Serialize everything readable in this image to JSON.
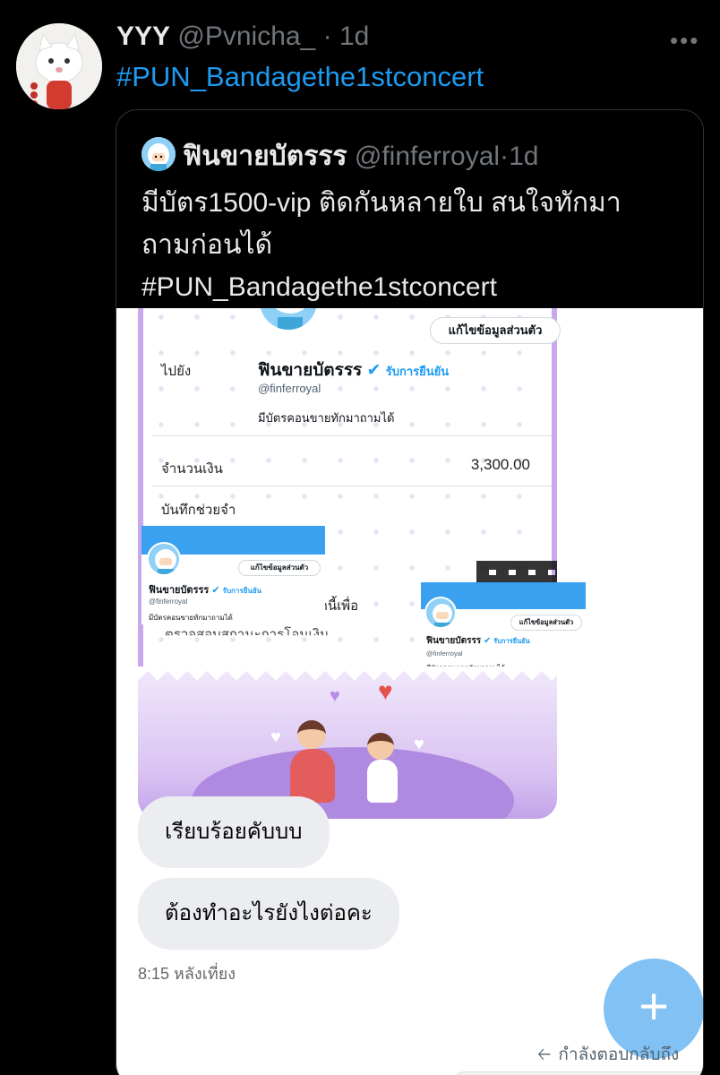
{
  "tweet": {
    "avatar_icon": "cat-avatar",
    "name": "YYY",
    "handle": "@Pvnicha_",
    "separator": "·",
    "time": "1d",
    "more_icon": "more-icon",
    "hashtag": "#PUN_Bandagethe1stconcert"
  },
  "quote": {
    "name": "ฟินขายบัตรรร",
    "handle": "@finferroyal",
    "separator": "·",
    "time": "1d",
    "text_line1": "มีบัตร1500-vip ติดกันหลายใบ สนใจทักมา",
    "text_line2": "ถามก่อนได้",
    "hashtag": "#PUN_Bandagethe1stconcert"
  },
  "screenshot": {
    "slip": {
      "to_label": "ไปยัง",
      "amount_label": "จำนวนเงิน",
      "amount_value": "3,300.00",
      "memo_label": "บันทึกช่วยจำ",
      "qr_text_partial": "โค้ดนี้เพื่อ",
      "partial_bottom": "ตรวจสอบสถานะการโอนเงิน"
    },
    "profile_main": {
      "edit_button": "แก้ไขข้อมูลส่วนตัว",
      "name": "ฟินขายบัตรรร",
      "verified_icon": "✔",
      "verified_label": "รับการยืนยัน",
      "handle": "@finferroyal",
      "bio": "มีบัตรคอนขายทักมาถามได้"
    },
    "profile_small_a": {
      "edit_button": "แก้ไขข้อมูลส่วนตัว",
      "name": "ฟินขายบัตรรร",
      "verified_icon": "✔",
      "verified_label": "รับการยืนยัน",
      "handle": "@finferroyal",
      "bio": "มีบัตรคอนขายทักมาถามได้"
    },
    "profile_small_b": {
      "edit_button": "แก้ไขข้อมูลส่วนตัว",
      "name": "ฟินขายบัตรรร",
      "verified_icon": "✔",
      "verified_label": "รับการยืนยัน",
      "handle": "@finferroyal",
      "bio": "มีบัตรคอนขายทักมาถามได้"
    },
    "chat": {
      "bubble1": "เรียบร้อยคับบบ",
      "bubble2": "ต้องทำอะไรยังไงต่อคะ",
      "time": "8:15 หลังเที่ยง"
    },
    "fab_icon": "+",
    "reply_arrow_icon": "🡠",
    "reply_to": "กำลังตอบกลับถึง"
  },
  "colors": {
    "background": "#000000",
    "link": "#1d9bf0",
    "muted": "#71767b",
    "slip_border": "#c9a8ee"
  }
}
